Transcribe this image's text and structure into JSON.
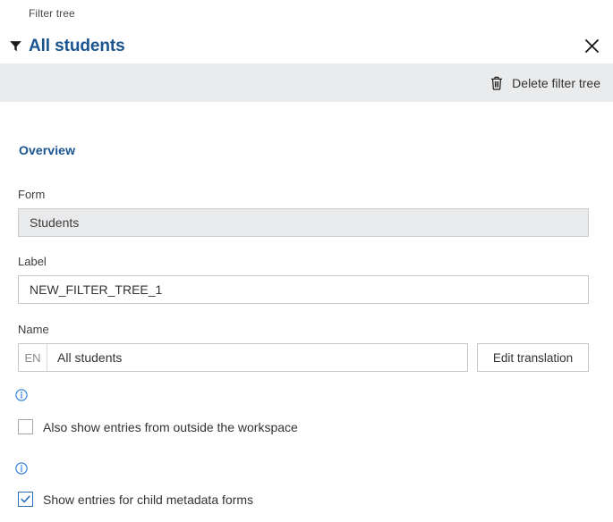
{
  "breadcrumb": "Filter tree",
  "header": {
    "title": "All students",
    "filter_icon": "filter-icon",
    "close_icon": "close-icon",
    "title_color": "#1a5490"
  },
  "toolbar": {
    "delete_label": "Delete filter tree",
    "delete_icon": "trash-icon",
    "background": "#eaebec"
  },
  "overview": {
    "section_title": "Overview",
    "form": {
      "label": "Form",
      "value": "Students",
      "readonly": true
    },
    "label_field": {
      "label": "Label",
      "value": "NEW_FILTER_TREE_1"
    },
    "name_field": {
      "label": "Name",
      "language": "EN",
      "value": "All students",
      "edit_translation_label": "Edit translation"
    },
    "options": [
      {
        "info_icon": "info-icon",
        "label": "Also show entries from outside the workspace",
        "checked": false
      },
      {
        "info_icon": "info-icon",
        "label": "Show entries for child metadata forms",
        "checked": true
      }
    ]
  },
  "colors": {
    "accent": "#1a5490",
    "checkbox_checked": "#2a6ebb",
    "info": "#2a7ade"
  }
}
